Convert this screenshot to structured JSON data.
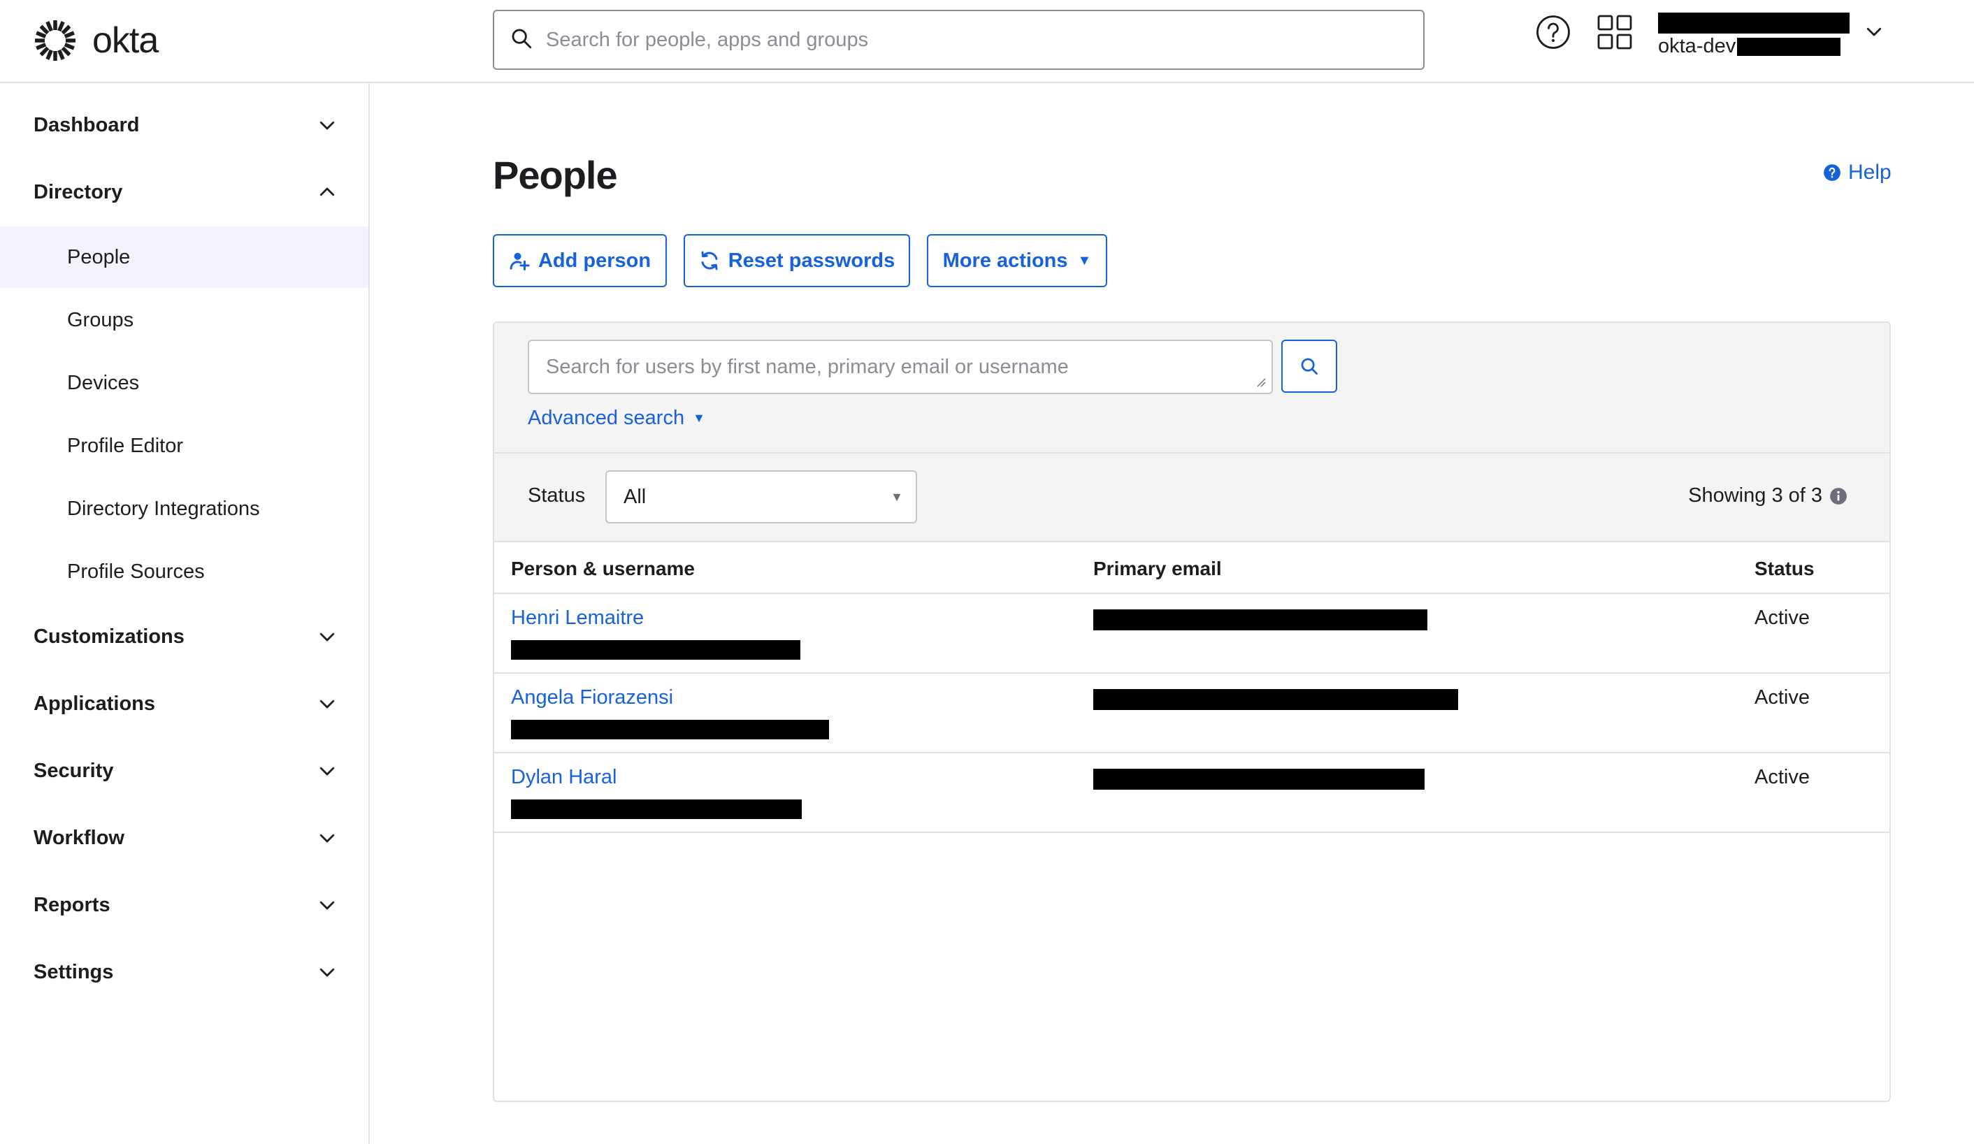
{
  "brand": {
    "name": "okta"
  },
  "global_search": {
    "placeholder": "Search for people, apps and groups"
  },
  "user_menu": {
    "org_prefix": "okta-dev"
  },
  "sidebar": {
    "sections": [
      {
        "label": "Dashboard",
        "expanded": false
      },
      {
        "label": "Directory",
        "expanded": true,
        "items": [
          "People",
          "Groups",
          "Devices",
          "Profile Editor",
          "Directory Integrations",
          "Profile Sources"
        ]
      },
      {
        "label": "Customizations",
        "expanded": false
      },
      {
        "label": "Applications",
        "expanded": false
      },
      {
        "label": "Security",
        "expanded": false
      },
      {
        "label": "Workflow",
        "expanded": false
      },
      {
        "label": "Reports",
        "expanded": false
      },
      {
        "label": "Settings",
        "expanded": false
      }
    ],
    "active_item": "People"
  },
  "page": {
    "title": "People",
    "help_label": "Help",
    "actions": {
      "add": "Add person",
      "reset": "Reset passwords",
      "more": "More actions"
    }
  },
  "user_search": {
    "placeholder": "Search for users by first name, primary email or username",
    "advanced_label": "Advanced search"
  },
  "filter": {
    "status_label": "Status",
    "status_value": "All",
    "showing": "Showing 3 of 3"
  },
  "table": {
    "columns": [
      "Person & username",
      "Primary email",
      "Status"
    ],
    "rows": [
      {
        "name": "Henri Lemaitre",
        "status": "Active"
      },
      {
        "name": "Angela Fiorazensi",
        "status": "Active"
      },
      {
        "name": "Dylan Haral",
        "status": "Active"
      }
    ]
  },
  "colors": {
    "accent": "#1662dd",
    "active_nav_bg": "#f2f3fd",
    "panel_bg": "#f4f4f4",
    "border": "#e1e1e1"
  }
}
